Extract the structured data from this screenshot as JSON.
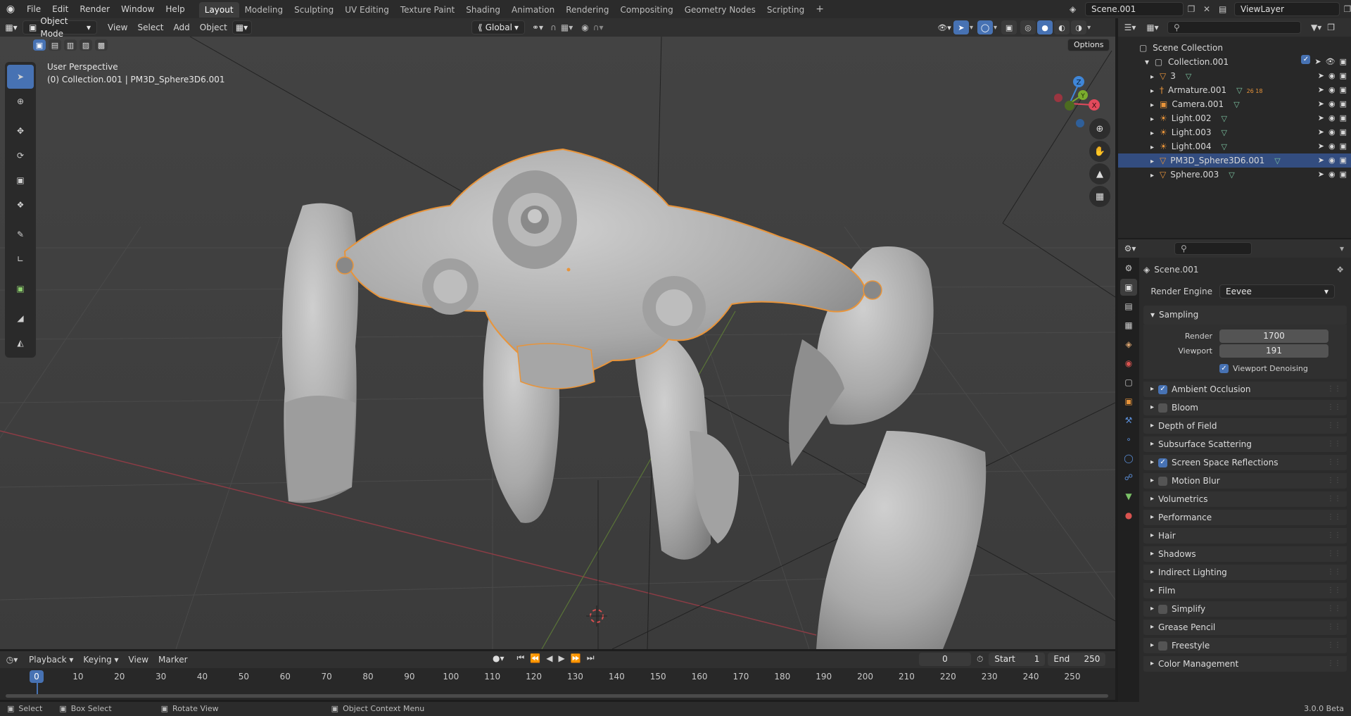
{
  "menu": {
    "items": [
      "File",
      "Edit",
      "Render",
      "Window",
      "Help"
    ],
    "workspaces": [
      "Layout",
      "Modeling",
      "Sculpting",
      "UV Editing",
      "Texture Paint",
      "Shading",
      "Animation",
      "Rendering",
      "Compositing",
      "Geometry Nodes",
      "Scripting"
    ],
    "active_workspace": "Layout",
    "add_tab_glyph": "+",
    "scene": "Scene.001",
    "view_layer": "ViewLayer"
  },
  "viewport_header": {
    "mode": "Object Mode",
    "menus": [
      "View",
      "Select",
      "Add",
      "Object"
    ],
    "orientation": "Global"
  },
  "viewport": {
    "perspective": "User Perspective",
    "context": "(0) Collection.001 | PM3D_Sphere3D6.001",
    "options_label": "Options",
    "gizmo_axes": [
      "X",
      "Y",
      "Z"
    ]
  },
  "colors": {
    "accent": "#4772b3",
    "selection_outline": "#e8943a",
    "axis_x": "#e24a5c",
    "axis_y": "#7bac2d",
    "axis_z": "#3f86d8"
  },
  "outliner": {
    "root": "Scene Collection",
    "collection": "Collection.001",
    "items": [
      {
        "name": "3",
        "icon": "mesh-icon"
      },
      {
        "name": "Armature.001",
        "icon": "armature-icon",
        "badge": "26  18"
      },
      {
        "name": "Camera.001",
        "icon": "camera-icon"
      },
      {
        "name": "Light.002",
        "icon": "light-icon"
      },
      {
        "name": "Light.003",
        "icon": "light-icon"
      },
      {
        "name": "Light.004",
        "icon": "light-icon"
      },
      {
        "name": "PM3D_Sphere3D6.001",
        "icon": "mesh-icon",
        "selected": true
      },
      {
        "name": "Sphere.003",
        "icon": "mesh-icon"
      }
    ]
  },
  "properties": {
    "scene_name": "Scene.001",
    "render_engine_label": "Render Engine",
    "render_engine": "Eevee",
    "sampling": {
      "title": "Sampling",
      "render_label": "Render",
      "render": "1700",
      "viewport_label": "Viewport",
      "viewport": "191",
      "denoise_label": "Viewport Denoising"
    },
    "panels": [
      {
        "label": "Ambient Occlusion",
        "checkbox": true,
        "checked": true
      },
      {
        "label": "Bloom",
        "checkbox": true,
        "checked": false
      },
      {
        "label": "Depth of Field",
        "checkbox": false
      },
      {
        "label": "Subsurface Scattering",
        "checkbox": false
      },
      {
        "label": "Screen Space Reflections",
        "checkbox": true,
        "checked": true
      },
      {
        "label": "Motion Blur",
        "checkbox": true,
        "checked": false
      },
      {
        "label": "Volumetrics",
        "checkbox": false
      },
      {
        "label": "Performance",
        "checkbox": false
      },
      {
        "label": "Hair",
        "checkbox": false
      },
      {
        "label": "Shadows",
        "checkbox": false
      },
      {
        "label": "Indirect Lighting",
        "checkbox": false
      },
      {
        "label": "Film",
        "checkbox": false
      },
      {
        "label": "Simplify",
        "checkbox": true,
        "checked": false
      },
      {
        "label": "Grease Pencil",
        "checkbox": false
      },
      {
        "label": "Freestyle",
        "checkbox": true,
        "checked": false
      },
      {
        "label": "Color Management",
        "checkbox": false
      }
    ]
  },
  "timeline": {
    "menus": [
      "Playback",
      "Keying",
      "View",
      "Marker"
    ],
    "current_frame": "0",
    "start_label": "Start",
    "start": "1",
    "end_label": "End",
    "end": "250",
    "ticks": [
      "0",
      "10",
      "20",
      "30",
      "40",
      "50",
      "60",
      "70",
      "80",
      "90",
      "100",
      "110",
      "120",
      "130",
      "140",
      "150",
      "160",
      "170",
      "180",
      "190",
      "200",
      "210",
      "220",
      "230",
      "240",
      "250"
    ]
  },
  "status": {
    "select": "Select",
    "box_select": "Box Select",
    "rotate_view": "Rotate View",
    "context_menu": "Object Context Menu",
    "version": "3.0.0 Beta"
  }
}
